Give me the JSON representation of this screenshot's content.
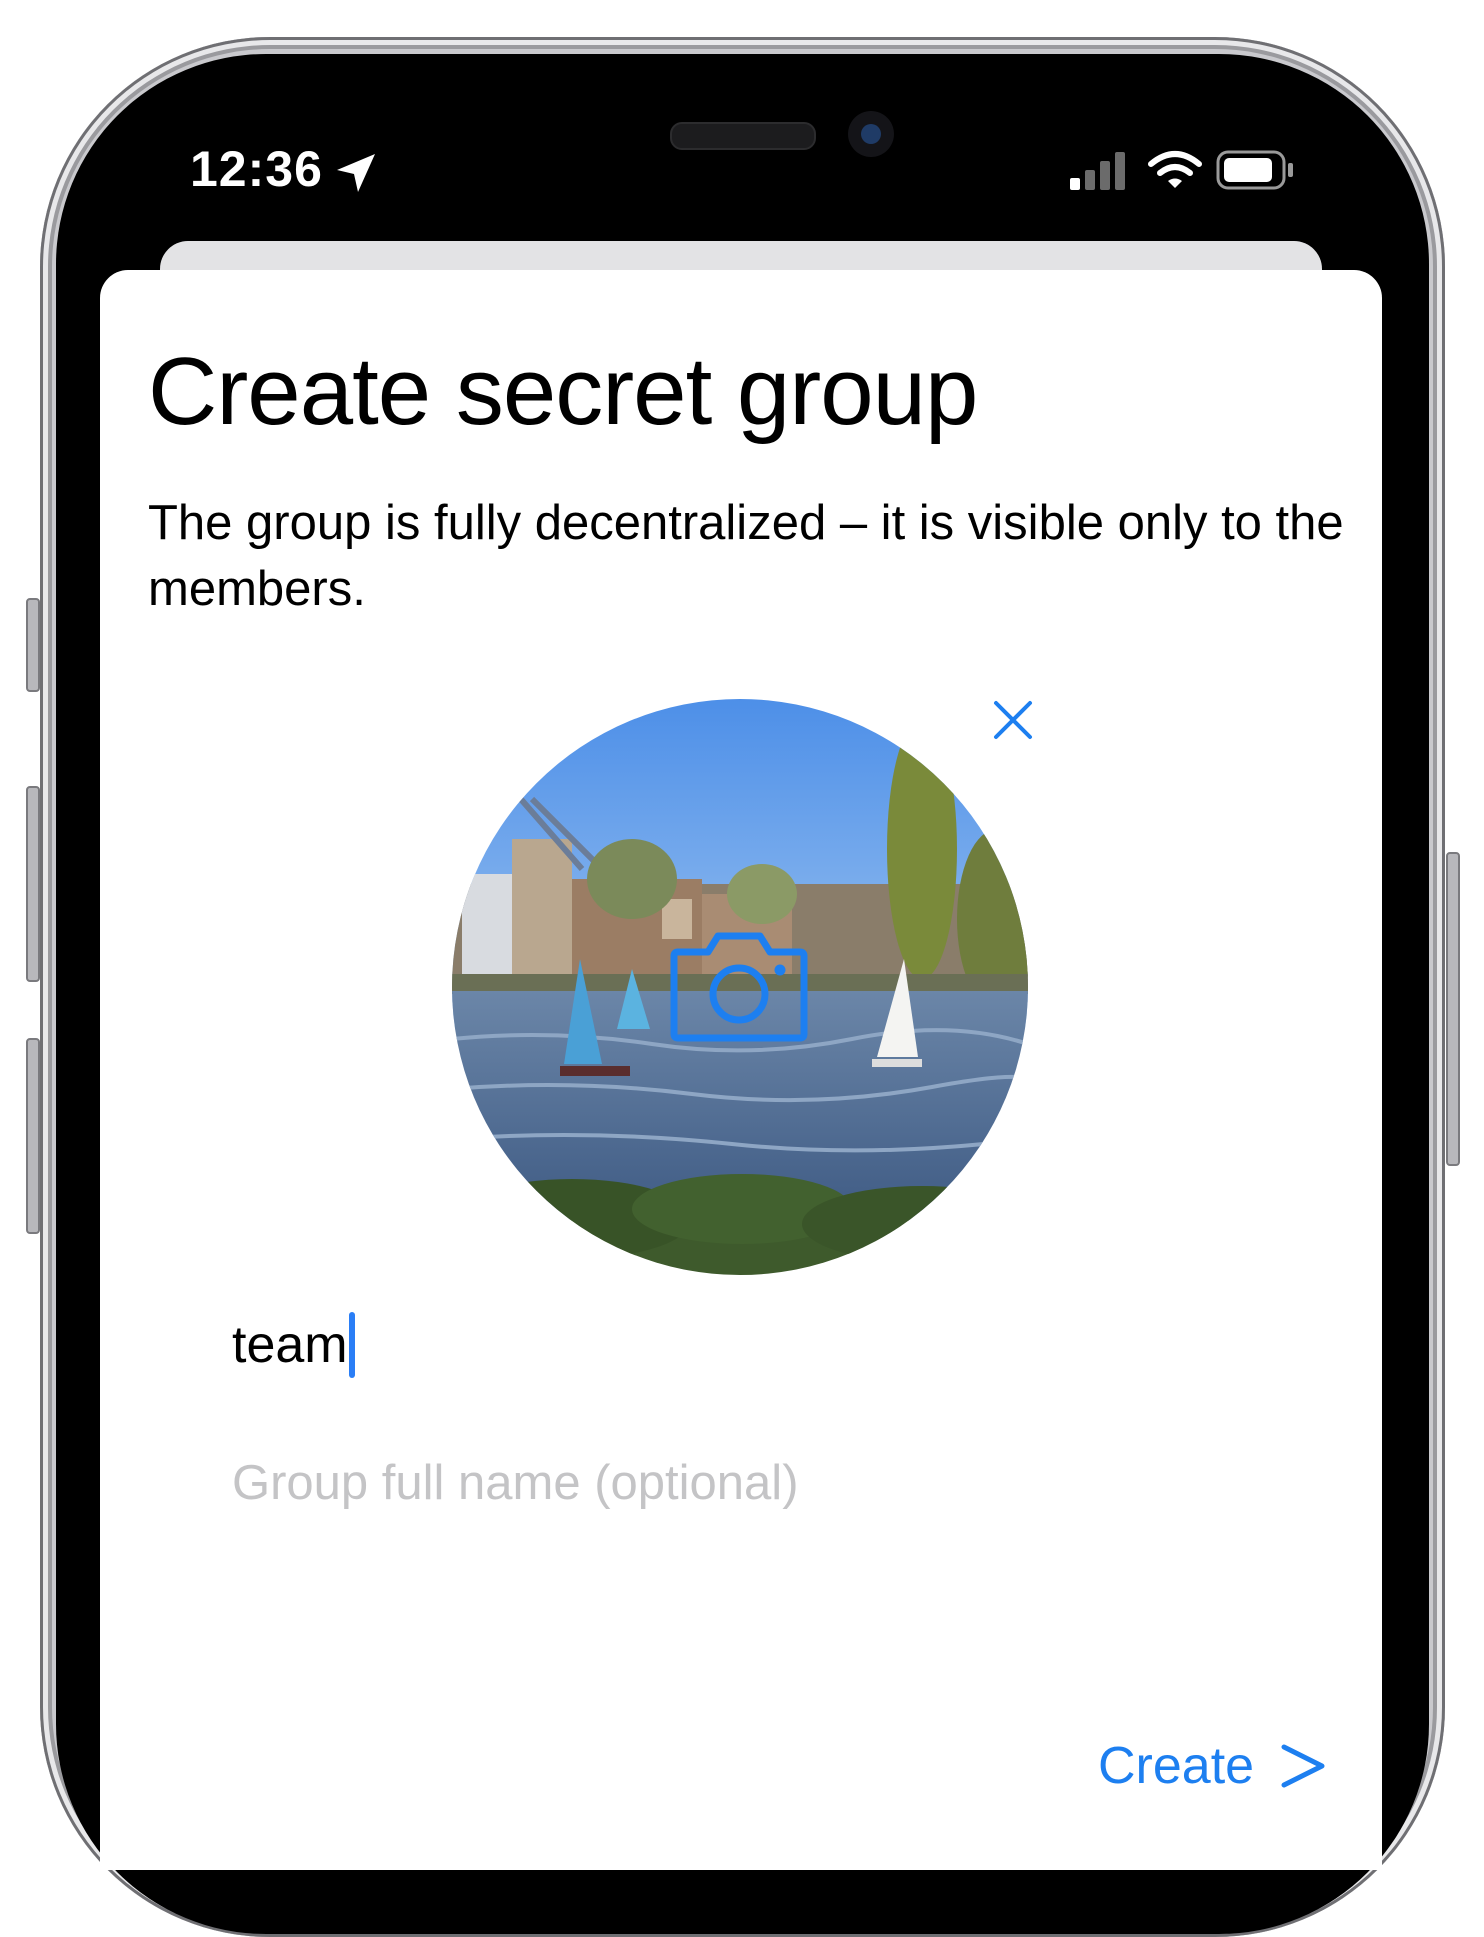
{
  "status_bar": {
    "time": "12:36",
    "location_icon": "location-arrow-icon",
    "signal_icon": "cellular-signal-icon",
    "wifi_icon": "wifi-icon",
    "battery_icon": "battery-icon"
  },
  "sheet": {
    "title": "Create secret group",
    "subtitle": "The group is fully decentralized – it is visible only to the members.",
    "avatar": {
      "camera_icon": "camera-icon",
      "remove_icon": "close-icon"
    },
    "fields": {
      "display_name_value": "team",
      "full_name_placeholder": "Group full name (optional)"
    },
    "create_label": "Create",
    "create_icon": "chevron-right-icon"
  },
  "colors": {
    "accent": "#1d7ff0",
    "placeholder": "#c4c4c6",
    "caret": "#2a7ef6"
  }
}
